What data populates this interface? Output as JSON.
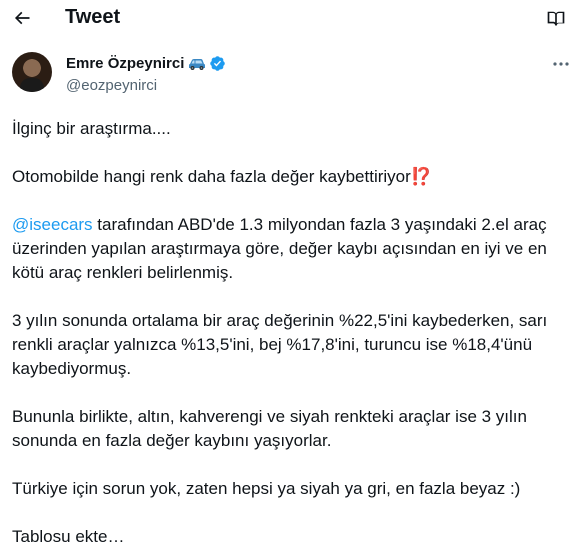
{
  "header": {
    "title": "Tweet",
    "back_icon": "arrow-left-icon",
    "reader_icon": "book-open-icon"
  },
  "author": {
    "name": "Emre Özpeynirci",
    "name_emoji": "car-icon",
    "verified_icon": "verified-badge-icon",
    "handle": "@eozpeynirci",
    "more_icon": "more-horizontal-icon"
  },
  "tweet": {
    "p1": "İlginç bir araştırma....",
    "p2_text": "Otomobilde hangi renk daha fazla değer kaybettiriyor",
    "p2_emoji": "⁉️",
    "p3_mention": "@iseecars",
    "p3_text": " tarafından ABD'de 1.3 milyondan fazla 3 yaşındaki 2.el araç üzerinden yapılan araştırmaya göre, değer kaybı açısından en iyi ve en kötü araç renkleri belirlenmiş.",
    "p4": "3 yılın sonunda ortalama bir araç değerinin %22,5'ini kaybederken, sarı renkli araçlar yalnızca %13,5'ini, bej %17,8'ini, turuncu ise %18,4'ünü kaybediyormuş.",
    "p5": "Bununla birlikte, altın, kahverengi ve siyah renkteki araçlar ise 3 yılın sonunda en fazla değer kaybını yaşıyorlar.",
    "p6": "Türkiye için sorun yok, zaten hepsi ya siyah ya gri, en fazla beyaz :)",
    "p7": "Tablosu ekte…"
  },
  "colors": {
    "text": "#0f1419",
    "secondary": "#536471",
    "link": "#1d9bf0",
    "verified": "#1d9bf0"
  }
}
